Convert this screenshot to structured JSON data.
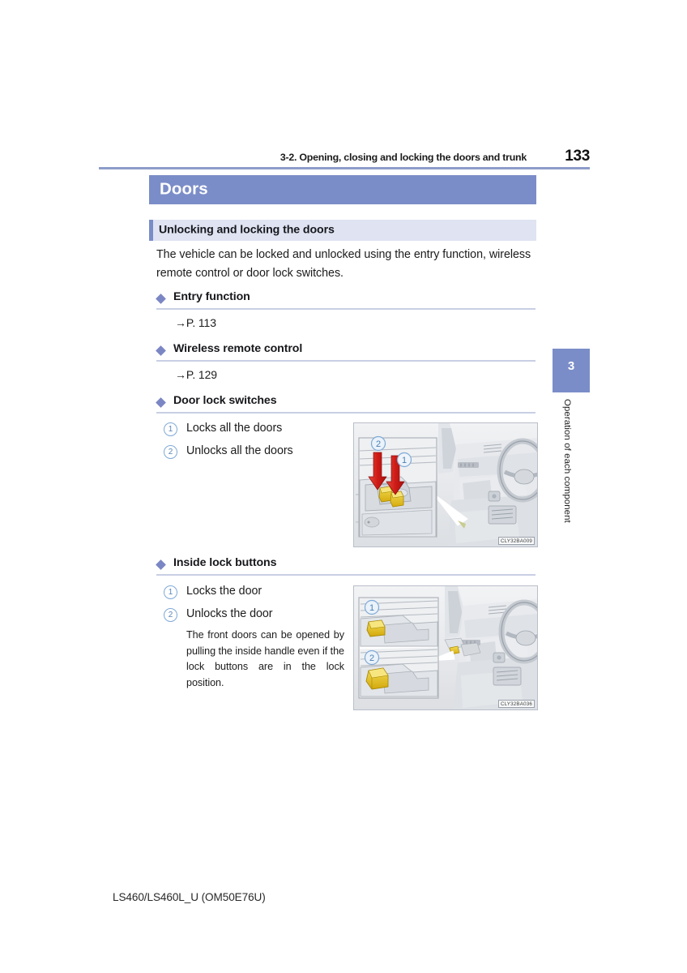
{
  "header": {
    "running_title": "3-2. Opening, closing and locking the doors and trunk",
    "page_number": "133"
  },
  "side_tab": {
    "chapter_number": "3",
    "chapter_label": "Operation of each component"
  },
  "section": {
    "title": "Doors"
  },
  "subsection": {
    "title": "Unlocking and locking the doors"
  },
  "intro": {
    "text": "The vehicle can be locked and unlocked using the entry function, wireless remote control or door lock switches."
  },
  "blocks": {
    "entry_function": {
      "heading": "Entry function",
      "page_ref": "→P. 113"
    },
    "wireless_remote": {
      "heading": "Wireless remote control",
      "page_ref": "→P. 129"
    },
    "door_lock_switches": {
      "heading": "Door lock switches",
      "items": [
        {
          "number": "1",
          "label": "Locks all the doors"
        },
        {
          "number": "2",
          "label": "Unlocks all the doors"
        }
      ],
      "figure": {
        "code": "CLY32BA009",
        "callouts": [
          {
            "number": "1"
          },
          {
            "number": "2"
          }
        ]
      }
    },
    "inside_lock_buttons": {
      "heading": "Inside lock buttons",
      "items": [
        {
          "number": "1",
          "label": "Locks the door"
        },
        {
          "number": "2",
          "label": "Unlocks the door"
        }
      ],
      "note": "The front doors can be opened by pulling the inside handle even if the lock buttons are in the lock position.",
      "figure": {
        "code": "CLY32BA036",
        "callouts": [
          {
            "number": "1"
          },
          {
            "number": "2"
          }
        ]
      }
    }
  },
  "footer": {
    "text": "LS460/LS460L_U (OM50E76U)"
  },
  "colors": {
    "accent_blue": "#7b8dc8",
    "accent_light": "#dfe3f2",
    "rule_blue": "#8d9cc9",
    "callout_blue": "#7fa9d6",
    "arrow_red": "#d72626",
    "button_yellow": "#e8c41f"
  }
}
